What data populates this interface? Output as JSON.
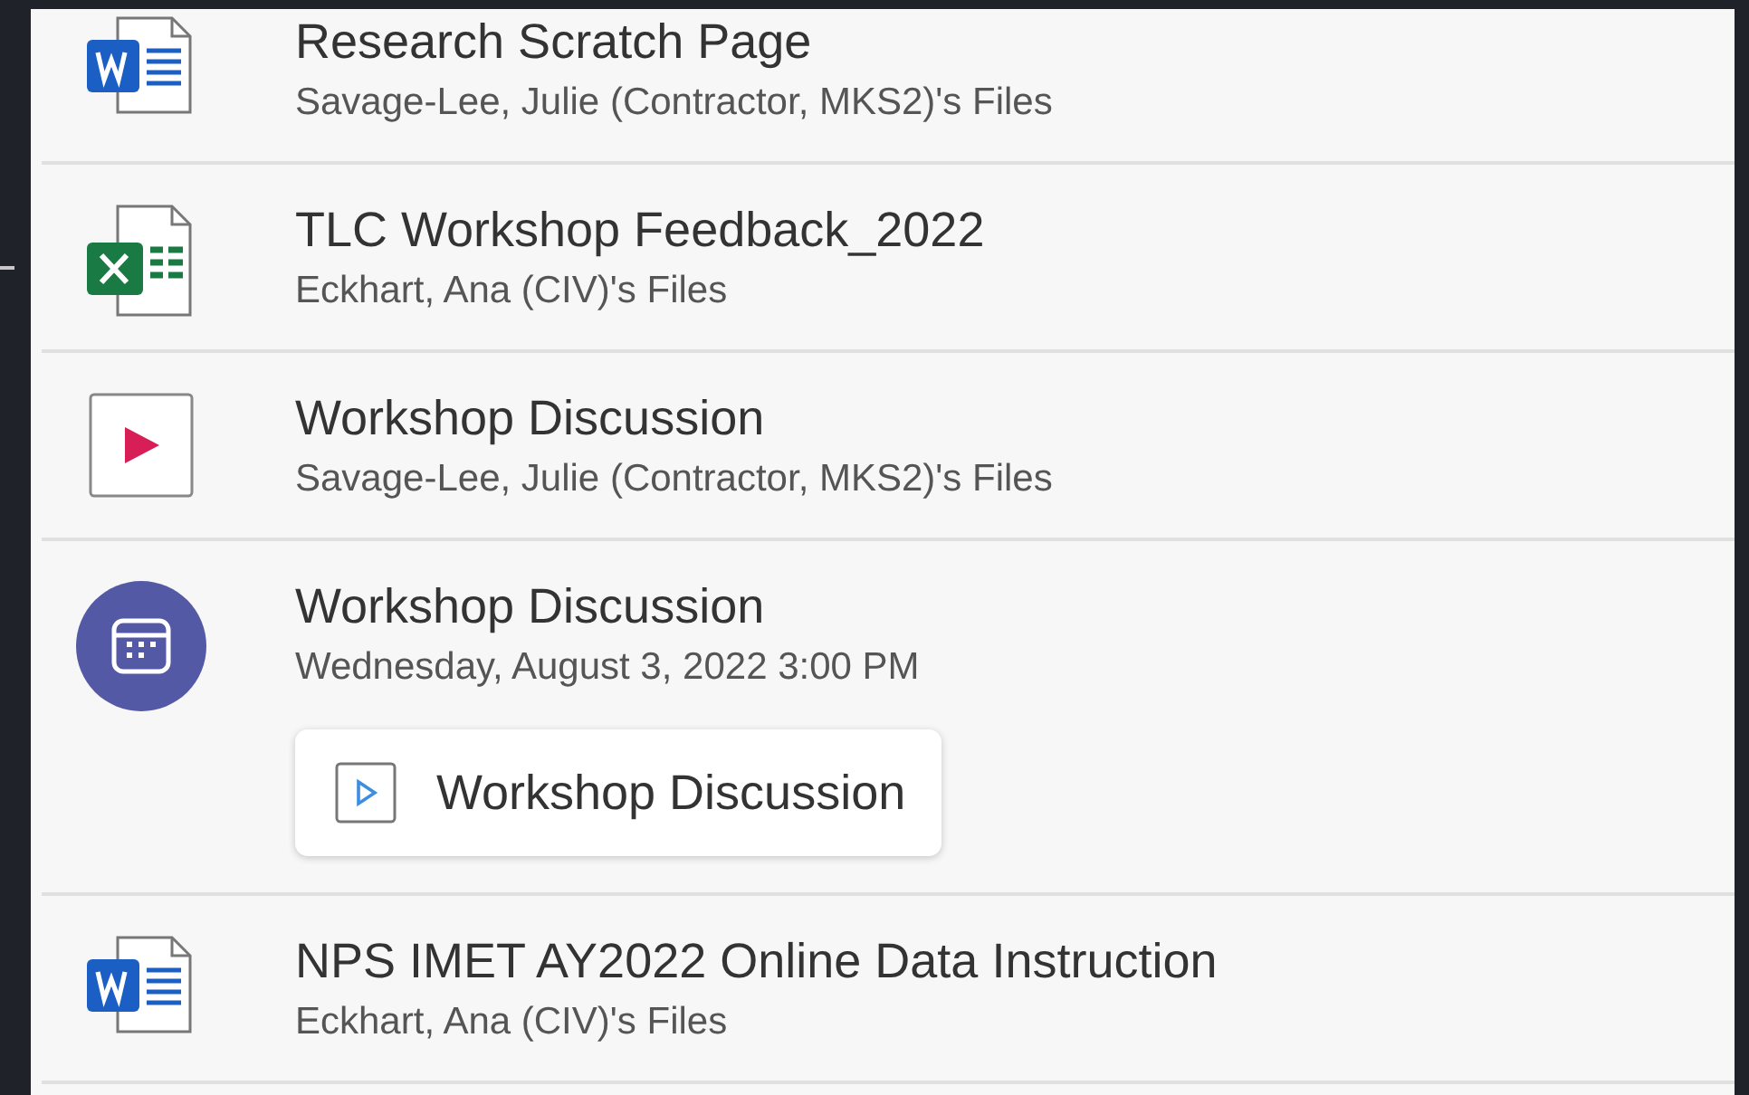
{
  "items": [
    {
      "kind": "word",
      "title": "Research Scratch Page",
      "subtitle": "Savage-Lee, Julie (Contractor, MKS2)'s Files"
    },
    {
      "kind": "excel",
      "title": "TLC Workshop Feedback_2022",
      "subtitle": "Eckhart, Ana (CIV)'s Files"
    },
    {
      "kind": "video",
      "title": "Workshop Discussion",
      "subtitle": "Savage-Lee, Julie (Contractor, MKS2)'s Files"
    },
    {
      "kind": "meeting",
      "title": "Workshop Discussion",
      "subtitle": "Wednesday, August 3, 2022 3:00 PM",
      "attachment": "Workshop Discussion"
    },
    {
      "kind": "word",
      "title": "NPS IMET AY2022 Online Data Instruction",
      "subtitle": "Eckhart, Ana (CIV)'s Files"
    }
  ]
}
